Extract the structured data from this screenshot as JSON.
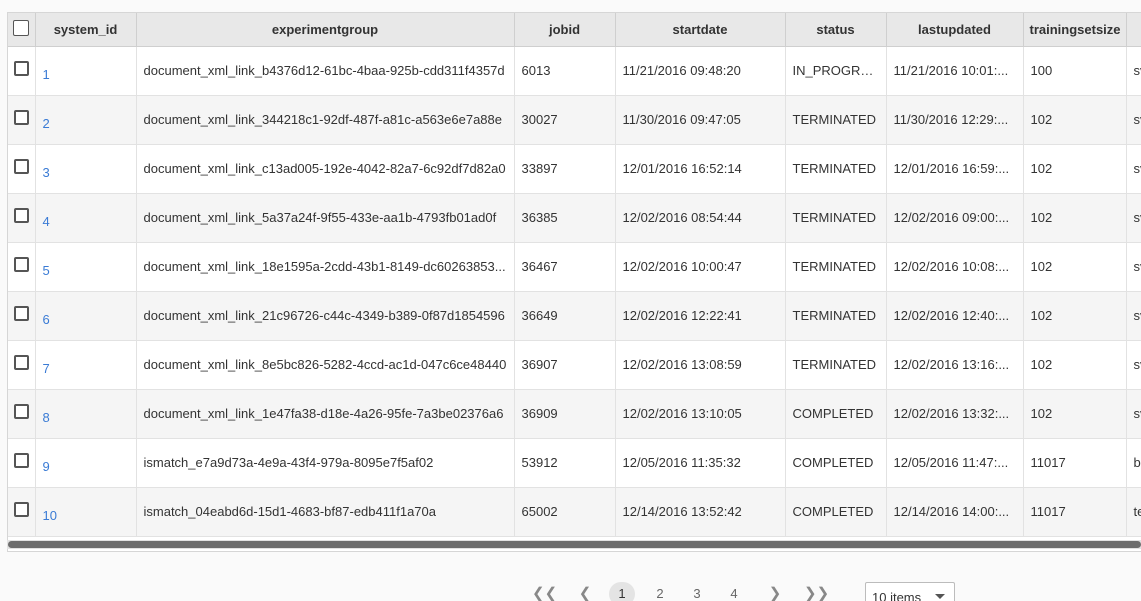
{
  "grid": {
    "columns": [
      "system_id",
      "experimentgroup",
      "jobid",
      "startdate",
      "status",
      "lastupdated",
      "trainingsetsize"
    ],
    "rows": [
      {
        "system_id": "1",
        "experimentgroup": "document_xml_link_b4376d12-61bc-4baa-925b-cdd311f4357d",
        "jobid": "6013",
        "startdate": "11/21/2016 09:48:20",
        "status": "IN_PROGRESS",
        "lastupdated": "11/21/2016 10:01:...",
        "trainingsetsize": "100",
        "extra": "sv"
      },
      {
        "system_id": "2",
        "experimentgroup": "document_xml_link_344218c1-92df-487f-a81c-a563e6e7a88e",
        "jobid": "30027",
        "startdate": "11/30/2016 09:47:05",
        "status": "TERMINATED",
        "lastupdated": "11/30/2016 12:29:...",
        "trainingsetsize": "102",
        "extra": "sv"
      },
      {
        "system_id": "3",
        "experimentgroup": "document_xml_link_c13ad005-192e-4042-82a7-6c92df7d82a0",
        "jobid": "33897",
        "startdate": "12/01/2016 16:52:14",
        "status": "TERMINATED",
        "lastupdated": "12/01/2016 16:59:...",
        "trainingsetsize": "102",
        "extra": "sv"
      },
      {
        "system_id": "4",
        "experimentgroup": "document_xml_link_5a37a24f-9f55-433e-aa1b-4793fb01ad0f",
        "jobid": "36385",
        "startdate": "12/02/2016 08:54:44",
        "status": "TERMINATED",
        "lastupdated": "12/02/2016 09:00:...",
        "trainingsetsize": "102",
        "extra": "sv"
      },
      {
        "system_id": "5",
        "experimentgroup": "document_xml_link_18e1595a-2cdd-43b1-8149-dc60263853...",
        "jobid": "36467",
        "startdate": "12/02/2016 10:00:47",
        "status": "TERMINATED",
        "lastupdated": "12/02/2016 10:08:...",
        "trainingsetsize": "102",
        "extra": "sv"
      },
      {
        "system_id": "6",
        "experimentgroup": "document_xml_link_21c96726-c44c-4349-b389-0f87d1854596",
        "jobid": "36649",
        "startdate": "12/02/2016 12:22:41",
        "status": "TERMINATED",
        "lastupdated": "12/02/2016 12:40:...",
        "trainingsetsize": "102",
        "extra": "sv"
      },
      {
        "system_id": "7",
        "experimentgroup": "document_xml_link_8e5bc826-5282-4ccd-ac1d-047c6ce48440",
        "jobid": "36907",
        "startdate": "12/02/2016 13:08:59",
        "status": "TERMINATED",
        "lastupdated": "12/02/2016 13:16:...",
        "trainingsetsize": "102",
        "extra": "sv"
      },
      {
        "system_id": "8",
        "experimentgroup": "document_xml_link_1e47fa38-d18e-4a26-95fe-7a3be02376a6",
        "jobid": "36909",
        "startdate": "12/02/2016 13:10:05",
        "status": "COMPLETED",
        "lastupdated": "12/02/2016 13:32:...",
        "trainingsetsize": "102",
        "extra": "sv"
      },
      {
        "system_id": "9",
        "experimentgroup": "ismatch_e7a9d73a-4e9a-43f4-979a-8095e7f5af02",
        "jobid": "53912",
        "startdate": "12/05/2016 11:35:32",
        "status": "COMPLETED",
        "lastupdated": "12/05/2016 11:47:...",
        "trainingsetsize": "11017",
        "extra": "bl"
      },
      {
        "system_id": "10",
        "experimentgroup": "ismatch_04eabd6d-15d1-4683-bf87-edb411f1a70a",
        "jobid": "65002",
        "startdate": "12/14/2016 13:52:42",
        "status": "COMPLETED",
        "lastupdated": "12/14/2016 14:00:...",
        "trainingsetsize": "11017",
        "extra": "te"
      }
    ]
  },
  "pager": {
    "first": "❮❮",
    "prev": "❮",
    "pages": [
      "1",
      "2",
      "3",
      "4"
    ],
    "current_page": "1",
    "next": "❯",
    "last": "❯❯",
    "page_size": "10 items"
  }
}
